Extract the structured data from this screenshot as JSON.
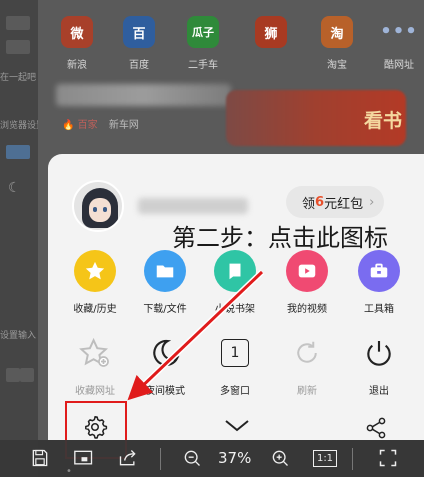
{
  "quick_links": [
    {
      "label": "新浪",
      "icon": "weibo-icon",
      "color": "#e8502e",
      "glyph": "微"
    },
    {
      "label": "百度",
      "icon": "baidu-paw-icon",
      "color": "#3b79d6",
      "glyph": "百"
    },
    {
      "label": "二手车",
      "icon": "guazi-icon",
      "color": "#3cb44a",
      "glyph": "瓜子"
    },
    {
      "label": "",
      "icon": "lion-icon",
      "color": "#d8442a",
      "glyph": "狮"
    },
    {
      "label": "淘宝",
      "icon": "taobao-icon",
      "color": "#f07a2a",
      "glyph": "淘"
    },
    {
      "label": "酷网址",
      "icon": "more-dots-icon",
      "color": "#5a5a5a",
      "glyph": "•••"
    }
  ],
  "news": {
    "hot_label": "🔥 百家",
    "sub_label": "新车网"
  },
  "promo": {
    "label": "看书"
  },
  "left_strip": {
    "texts": [
      "在一起吧",
      "浏览器设置",
      "设置输入"
    ]
  },
  "sheet": {
    "red_packet": {
      "prefix": "领",
      "amount": "6",
      "suffix": "元红包",
      "chevron": "›"
    },
    "row1": [
      {
        "label": "收藏/历史",
        "icon": "star-icon",
        "color": "#f5c518"
      },
      {
        "label": "下载/文件",
        "icon": "folder-icon",
        "color": "#3ea0f0"
      },
      {
        "label": "小说书架",
        "icon": "book-icon",
        "color": "#2fc5a5"
      },
      {
        "label": "我的视频",
        "icon": "video-play-icon",
        "color": "#f04a72"
      },
      {
        "label": "工具箱",
        "icon": "toolbox-icon",
        "color": "#7a6cf0"
      }
    ],
    "row2": [
      {
        "label": "收藏网址",
        "icon": "star-add-icon"
      },
      {
        "label": "夜间模式",
        "icon": "moon-icon"
      },
      {
        "label": "多窗口",
        "icon": "window-count-icon",
        "count": "1"
      },
      {
        "label": "刷新",
        "icon": "refresh-icon"
      },
      {
        "label": "退出",
        "icon": "power-icon"
      }
    ]
  },
  "annotation": {
    "text": "第二步：点击此图标",
    "color": "#e01b1b"
  },
  "viewer_toolbar": {
    "zoom": "37%",
    "fit_label": "1:1"
  }
}
